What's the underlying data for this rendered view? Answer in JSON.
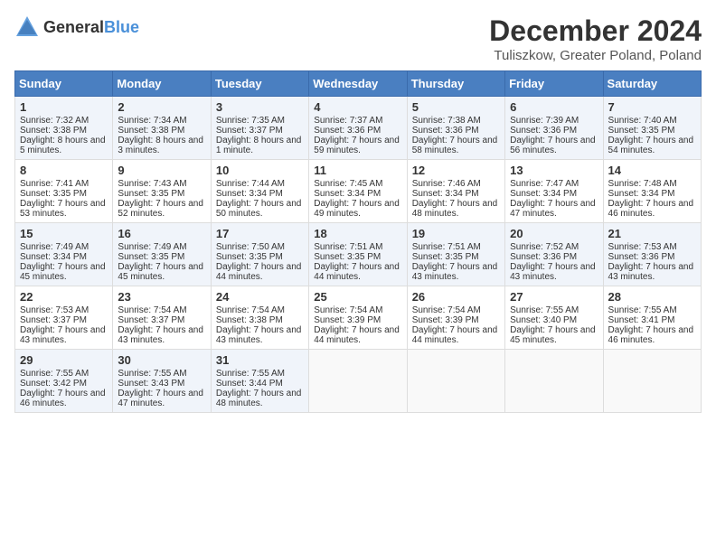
{
  "logo": {
    "general": "General",
    "blue": "Blue"
  },
  "title": "December 2024",
  "subtitle": "Tuliszkow, Greater Poland, Poland",
  "weekdays": [
    "Sunday",
    "Monday",
    "Tuesday",
    "Wednesday",
    "Thursday",
    "Friday",
    "Saturday"
  ],
  "weeks": [
    [
      {
        "day": "1",
        "sunrise": "Sunrise: 7:32 AM",
        "sunset": "Sunset: 3:38 PM",
        "daylight": "Daylight: 8 hours and 5 minutes."
      },
      {
        "day": "2",
        "sunrise": "Sunrise: 7:34 AM",
        "sunset": "Sunset: 3:38 PM",
        "daylight": "Daylight: 8 hours and 3 minutes."
      },
      {
        "day": "3",
        "sunrise": "Sunrise: 7:35 AM",
        "sunset": "Sunset: 3:37 PM",
        "daylight": "Daylight: 8 hours and 1 minute."
      },
      {
        "day": "4",
        "sunrise": "Sunrise: 7:37 AM",
        "sunset": "Sunset: 3:36 PM",
        "daylight": "Daylight: 7 hours and 59 minutes."
      },
      {
        "day": "5",
        "sunrise": "Sunrise: 7:38 AM",
        "sunset": "Sunset: 3:36 PM",
        "daylight": "Daylight: 7 hours and 58 minutes."
      },
      {
        "day": "6",
        "sunrise": "Sunrise: 7:39 AM",
        "sunset": "Sunset: 3:36 PM",
        "daylight": "Daylight: 7 hours and 56 minutes."
      },
      {
        "day": "7",
        "sunrise": "Sunrise: 7:40 AM",
        "sunset": "Sunset: 3:35 PM",
        "daylight": "Daylight: 7 hours and 54 minutes."
      }
    ],
    [
      {
        "day": "8",
        "sunrise": "Sunrise: 7:41 AM",
        "sunset": "Sunset: 3:35 PM",
        "daylight": "Daylight: 7 hours and 53 minutes."
      },
      {
        "day": "9",
        "sunrise": "Sunrise: 7:43 AM",
        "sunset": "Sunset: 3:35 PM",
        "daylight": "Daylight: 7 hours and 52 minutes."
      },
      {
        "day": "10",
        "sunrise": "Sunrise: 7:44 AM",
        "sunset": "Sunset: 3:34 PM",
        "daylight": "Daylight: 7 hours and 50 minutes."
      },
      {
        "day": "11",
        "sunrise": "Sunrise: 7:45 AM",
        "sunset": "Sunset: 3:34 PM",
        "daylight": "Daylight: 7 hours and 49 minutes."
      },
      {
        "day": "12",
        "sunrise": "Sunrise: 7:46 AM",
        "sunset": "Sunset: 3:34 PM",
        "daylight": "Daylight: 7 hours and 48 minutes."
      },
      {
        "day": "13",
        "sunrise": "Sunrise: 7:47 AM",
        "sunset": "Sunset: 3:34 PM",
        "daylight": "Daylight: 7 hours and 47 minutes."
      },
      {
        "day": "14",
        "sunrise": "Sunrise: 7:48 AM",
        "sunset": "Sunset: 3:34 PM",
        "daylight": "Daylight: 7 hours and 46 minutes."
      }
    ],
    [
      {
        "day": "15",
        "sunrise": "Sunrise: 7:49 AM",
        "sunset": "Sunset: 3:34 PM",
        "daylight": "Daylight: 7 hours and 45 minutes."
      },
      {
        "day": "16",
        "sunrise": "Sunrise: 7:49 AM",
        "sunset": "Sunset: 3:35 PM",
        "daylight": "Daylight: 7 hours and 45 minutes."
      },
      {
        "day": "17",
        "sunrise": "Sunrise: 7:50 AM",
        "sunset": "Sunset: 3:35 PM",
        "daylight": "Daylight: 7 hours and 44 minutes."
      },
      {
        "day": "18",
        "sunrise": "Sunrise: 7:51 AM",
        "sunset": "Sunset: 3:35 PM",
        "daylight": "Daylight: 7 hours and 44 minutes."
      },
      {
        "day": "19",
        "sunrise": "Sunrise: 7:51 AM",
        "sunset": "Sunset: 3:35 PM",
        "daylight": "Daylight: 7 hours and 43 minutes."
      },
      {
        "day": "20",
        "sunrise": "Sunrise: 7:52 AM",
        "sunset": "Sunset: 3:36 PM",
        "daylight": "Daylight: 7 hours and 43 minutes."
      },
      {
        "day": "21",
        "sunrise": "Sunrise: 7:53 AM",
        "sunset": "Sunset: 3:36 PM",
        "daylight": "Daylight: 7 hours and 43 minutes."
      }
    ],
    [
      {
        "day": "22",
        "sunrise": "Sunrise: 7:53 AM",
        "sunset": "Sunset: 3:37 PM",
        "daylight": "Daylight: 7 hours and 43 minutes."
      },
      {
        "day": "23",
        "sunrise": "Sunrise: 7:54 AM",
        "sunset": "Sunset: 3:37 PM",
        "daylight": "Daylight: 7 hours and 43 minutes."
      },
      {
        "day": "24",
        "sunrise": "Sunrise: 7:54 AM",
        "sunset": "Sunset: 3:38 PM",
        "daylight": "Daylight: 7 hours and 43 minutes."
      },
      {
        "day": "25",
        "sunrise": "Sunrise: 7:54 AM",
        "sunset": "Sunset: 3:39 PM",
        "daylight": "Daylight: 7 hours and 44 minutes."
      },
      {
        "day": "26",
        "sunrise": "Sunrise: 7:54 AM",
        "sunset": "Sunset: 3:39 PM",
        "daylight": "Daylight: 7 hours and 44 minutes."
      },
      {
        "day": "27",
        "sunrise": "Sunrise: 7:55 AM",
        "sunset": "Sunset: 3:40 PM",
        "daylight": "Daylight: 7 hours and 45 minutes."
      },
      {
        "day": "28",
        "sunrise": "Sunrise: 7:55 AM",
        "sunset": "Sunset: 3:41 PM",
        "daylight": "Daylight: 7 hours and 46 minutes."
      }
    ],
    [
      {
        "day": "29",
        "sunrise": "Sunrise: 7:55 AM",
        "sunset": "Sunset: 3:42 PM",
        "daylight": "Daylight: 7 hours and 46 minutes."
      },
      {
        "day": "30",
        "sunrise": "Sunrise: 7:55 AM",
        "sunset": "Sunset: 3:43 PM",
        "daylight": "Daylight: 7 hours and 47 minutes."
      },
      {
        "day": "31",
        "sunrise": "Sunrise: 7:55 AM",
        "sunset": "Sunset: 3:44 PM",
        "daylight": "Daylight: 7 hours and 48 minutes."
      },
      null,
      null,
      null,
      null
    ]
  ]
}
